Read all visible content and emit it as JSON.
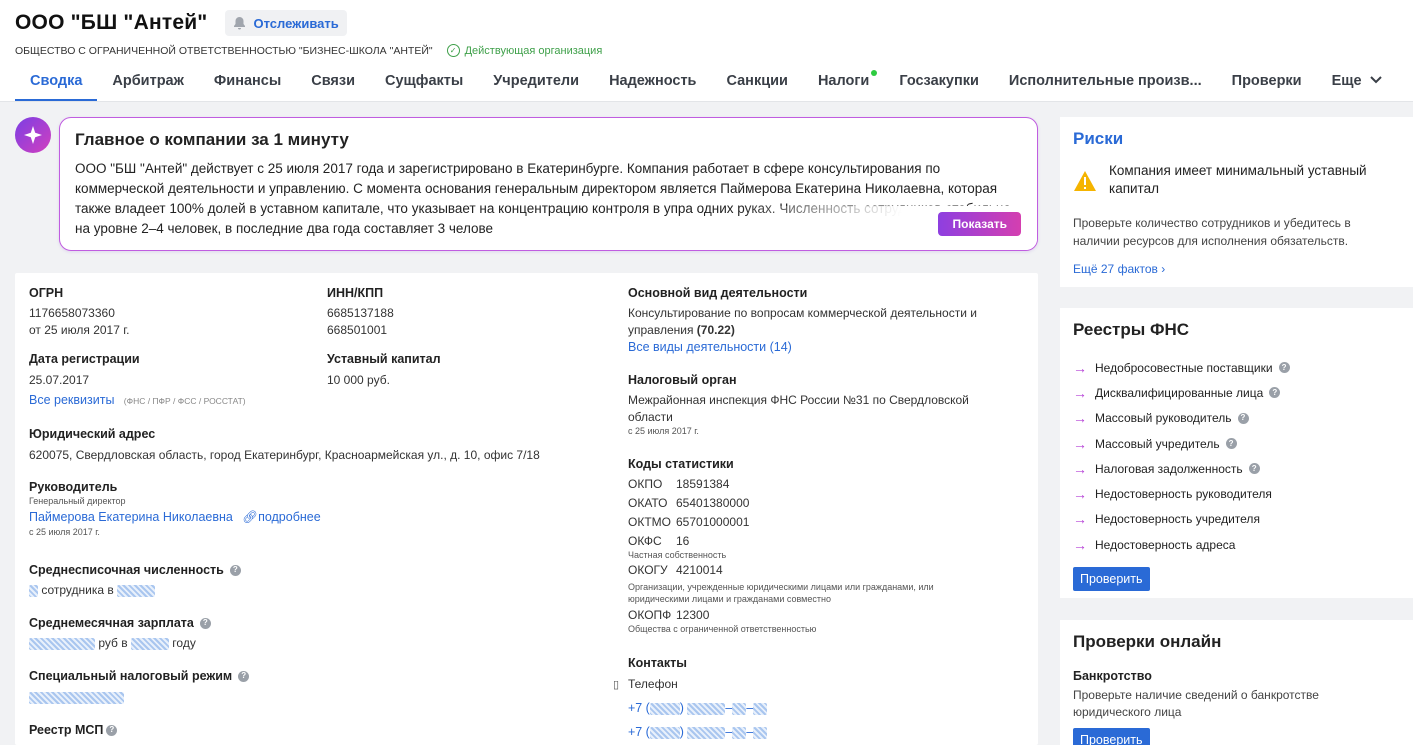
{
  "header": {
    "company_name": "ООО \"БШ \"Антей\"",
    "follow_label": "Отслеживать",
    "full_name": "ОБЩЕСТВО С ОГРАНИЧЕННОЙ ОТВЕТСТВЕННОСТЬЮ \"БИЗНЕС-ШКОЛА \"АНТЕЙ\"",
    "status": "Действующая организация"
  },
  "tabs": [
    {
      "label": "Сводка",
      "active": true
    },
    {
      "label": "Арбитраж"
    },
    {
      "label": "Финансы"
    },
    {
      "label": "Связи"
    },
    {
      "label": "Сущфакты"
    },
    {
      "label": "Учредители"
    },
    {
      "label": "Надежность"
    },
    {
      "label": "Санкции"
    },
    {
      "label": "Налоги",
      "has_dot": true
    },
    {
      "label": "Госзакупки"
    },
    {
      "label": "Исполнительные произв..."
    },
    {
      "label": "Проверки"
    },
    {
      "label": "Еще"
    }
  ],
  "ai_summary": {
    "title": "Главное о компании за 1 минуту",
    "text": "ООО \"БШ \"Антей\" действует с 25 июля 2017 года и зарегистрировано в Екатеринбурге. Компания работает в сфере консультирования по коммерческой деятельности и управлению. С момента основания генеральным директором является Паймерова Екатерина Николаевна, которая также владеет 100% долей в уставном капитале, что указывает на концентрацию контроля в упра одних руках. Численность сотрудников стабильна на уровне 2–4 человек, в последние два года составляет 3 челове",
    "show_label": "Показать"
  },
  "details": {
    "ogrn_label": "ОГРН",
    "ogrn_value": "1176658073360",
    "ogrn_date": "от 25 июля 2017 г.",
    "inn_label": "ИНН/КПП",
    "inn_value": "6685137188",
    "kpp_value": "668501001",
    "reg_date_label": "Дата регистрации",
    "reg_date_value": "25.07.2017",
    "capital_label": "Уставный капитал",
    "capital_value": "10 000 руб.",
    "all_requisites": "Все реквизиты",
    "requisites_note": "(ФНС / ПФР / ФСС / РОССТАТ)",
    "address_label": "Юридический адрес",
    "address_value": "620075, Свердловская область, город Екатеринбург, Красноармейская ул., д. 10, офис 7/18",
    "director_label": "Руководитель",
    "director_role": "Генеральный директор",
    "director_name": "Паймерова Екатерина Николаевна",
    "director_more": "подробнее",
    "director_since": "с 25 июля 2017 г.",
    "employees_label": "Среднесписочная численность",
    "employees_text_1": "сотрудника в",
    "salary_label": "Среднемесячная зарплата",
    "salary_text_1": "руб в",
    "salary_text_2": "году",
    "tax_regime_label": "Специальный налоговый режим",
    "msp_label": "Реестр МСП",
    "activity_label": "Основной вид деятельности",
    "activity_value": "Консультирование по вопросам коммерческой деятельности и управления",
    "activity_code": "(70.22)",
    "activity_all": "Все виды деятельности (14)",
    "tax_org_label": "Налоговый орган",
    "tax_org_value": "Межрайонная инспекция ФНС России №31 по Свердловской области",
    "tax_org_since": "с 25 июля 2017 г.",
    "stats_label": "Коды статистики",
    "okpo": "ОКПО",
    "okpo_value": "18591384",
    "okato": "ОКАТО",
    "okato_value": "65401380000",
    "oktmo": "ОКТМО",
    "oktmo_value": "65701000001",
    "okfs": "ОКФС",
    "okfs_value": "16",
    "okfs_note": "Частная собственность",
    "okogu": "ОКОГУ",
    "okogu_value": "4210014",
    "okogu_note": "Организации, учрежденные юридическими лицами или гражданами, или юридическими лицами и гражданами совместно",
    "okopf": "ОКОПФ",
    "okopf_value": "12300",
    "okopf_note": "Общества с ограниченной ответственностью",
    "contacts_label": "Контакты",
    "phone_label": "Телефон",
    "phone_prefix": "+7"
  },
  "risks": {
    "title": "Риски",
    "warning": "Компания имеет минимальный уставный капитал",
    "description": "Проверьте количество сотрудников и убедитесь в наличии ресурсов для исполнения обязательств.",
    "more": "Ещё 27 фактов"
  },
  "registries": {
    "title": "Реестры ФНС",
    "items": [
      {
        "label": "Недобросовестные поставщики",
        "help": true
      },
      {
        "label": "Дисквалифицированные лица",
        "help": true
      },
      {
        "label": "Массовый руководитель",
        "help": true
      },
      {
        "label": "Массовый учредитель",
        "help": true
      },
      {
        "label": "Налоговая задолженность",
        "help": true
      },
      {
        "label": "Недостоверность руководителя",
        "help": false
      },
      {
        "label": "Недостоверность учредителя",
        "help": false
      },
      {
        "label": "Недостоверность адреса",
        "help": false
      }
    ],
    "check_label": "Проверить"
  },
  "online_checks": {
    "title": "Проверки онлайн",
    "bankruptcy_label": "Банкротство",
    "bankruptcy_desc": "Проверьте наличие сведений о банкротстве юридического лица",
    "check_label": "Проверить"
  }
}
